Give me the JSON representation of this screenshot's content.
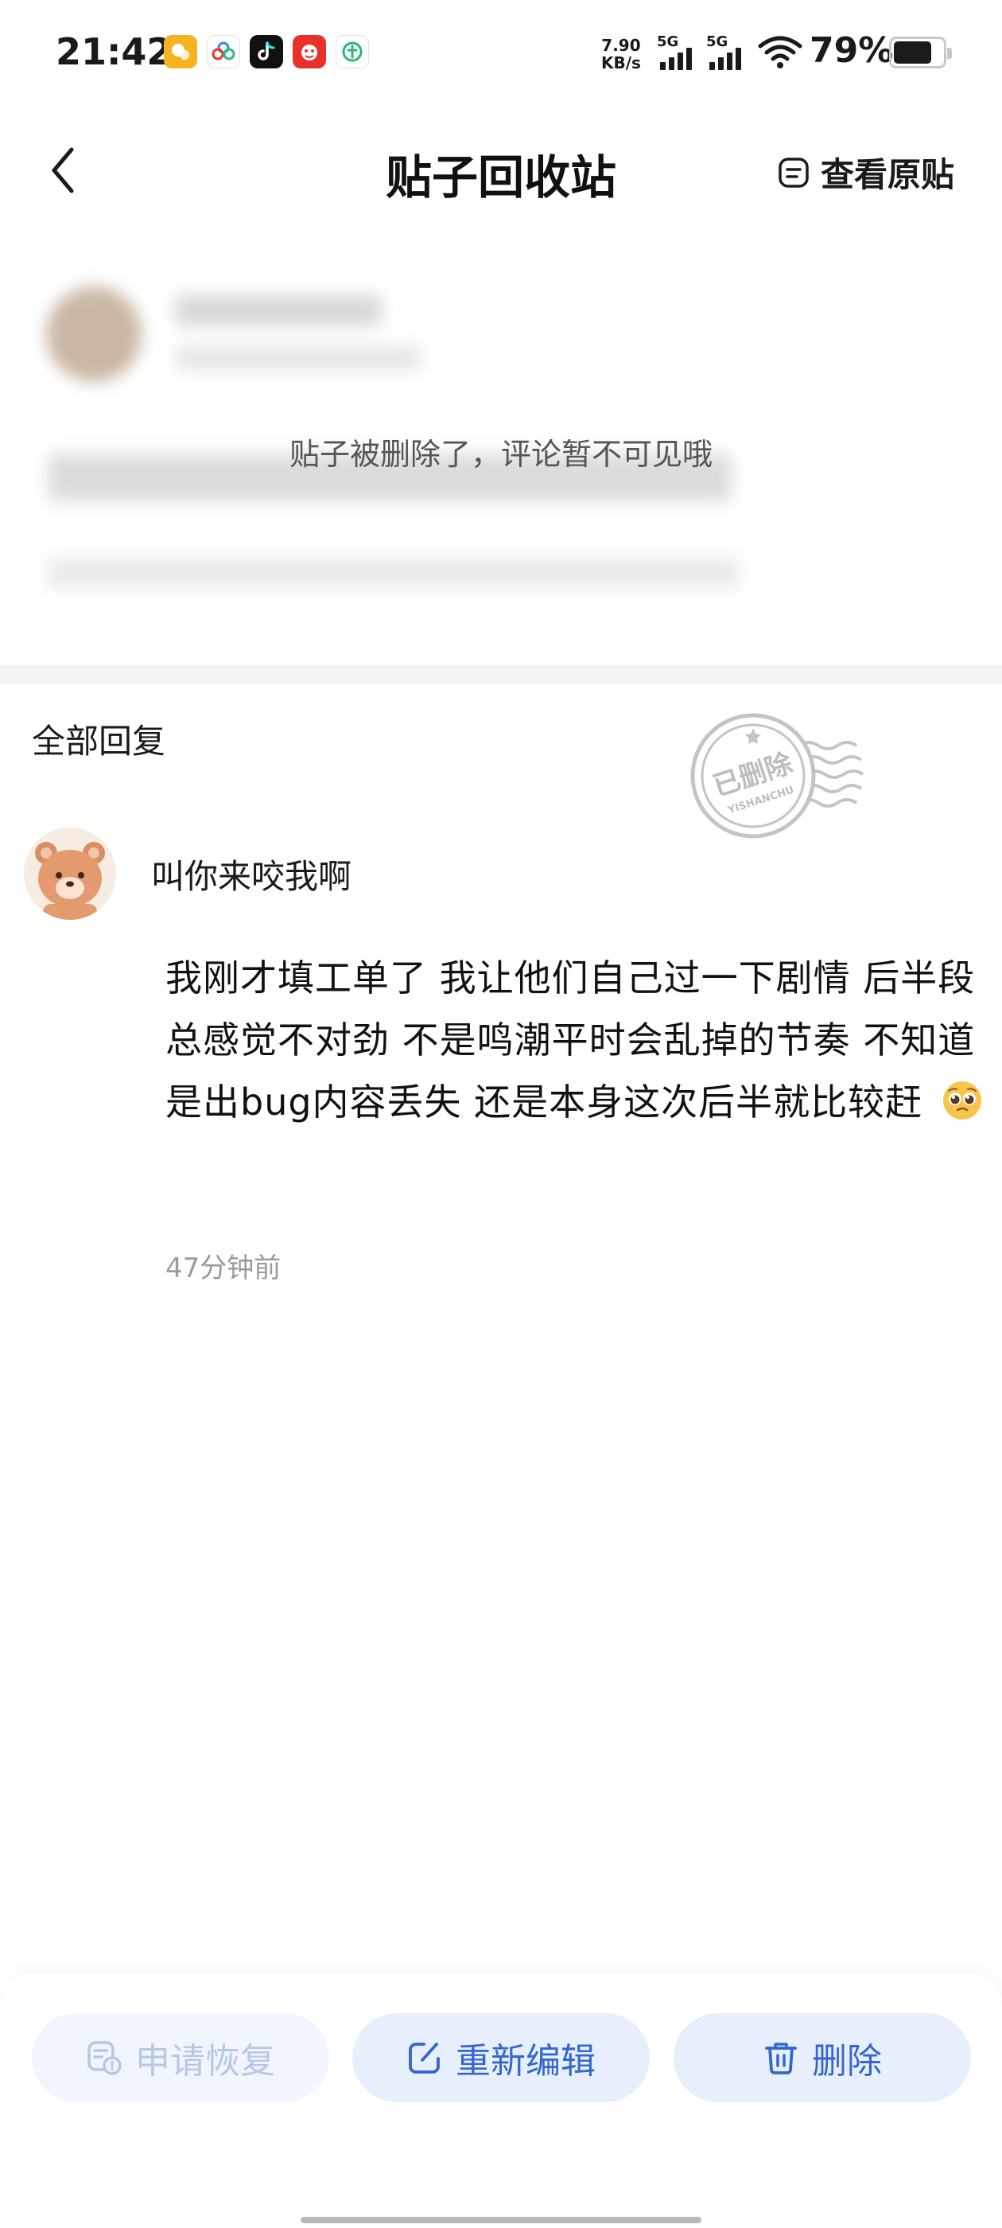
{
  "status_bar": {
    "time": "21:42",
    "network_speed_value": "7.90",
    "network_speed_unit": "KB/s",
    "sim1_label": "5G",
    "sim2_label": "5G",
    "battery_percent": "79%",
    "battery_level": 0.79,
    "app_icons": [
      "app-notification-icon",
      "baidu-netdisk-icon",
      "tiktok-icon",
      "app-notification-icon-2",
      "app-notification-icon-3"
    ]
  },
  "header": {
    "title": "贴子回收站",
    "view_original_label": "查看原贴"
  },
  "post": {
    "deleted_notice": "贴子被删除了，评论暂不可见哦"
  },
  "replies": {
    "heading": "全部回复",
    "stamp_text": "已删除",
    "stamp_subtext": "YISHANCHU",
    "items": [
      {
        "username": "叫你来咬我啊",
        "text": "我刚才填工单了 我让他们自己过一下剧情 后半段总感觉不对劲 不是鸣潮平时会乱掉的节奏 不知道是出bug内容丢失 还是本身这次后半就比较赶",
        "time": "47分钟前"
      }
    ]
  },
  "actions": {
    "restore_label": "申请恢复",
    "edit_label": "重新编辑",
    "delete_label": "删除"
  },
  "colors": {
    "accent": "#3466d0",
    "button_bg": "#e8effc",
    "disabled_text": "#b7c7e8",
    "stamp": "#bdbdbd"
  }
}
